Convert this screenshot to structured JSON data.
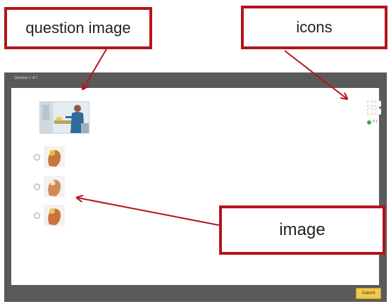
{
  "annotations": {
    "question_image": "question image",
    "icons": "icons",
    "image": "image"
  },
  "window": {
    "title": "Question 1 of 1"
  },
  "question": {
    "image_icon": "question-photo-icon"
  },
  "icons": {
    "status_text": "0 1",
    "status_color": "#3caa3c"
  },
  "options": [
    {
      "image_icon": "hand-icon"
    },
    {
      "image_icon": "hand-icon"
    },
    {
      "image_icon": "hand-icon"
    }
  ],
  "submit_label": "Submit",
  "colors": {
    "callout_border": "#b3141c",
    "frame_bg": "#5a5a5a",
    "submit_bg": "#f2c94c"
  }
}
